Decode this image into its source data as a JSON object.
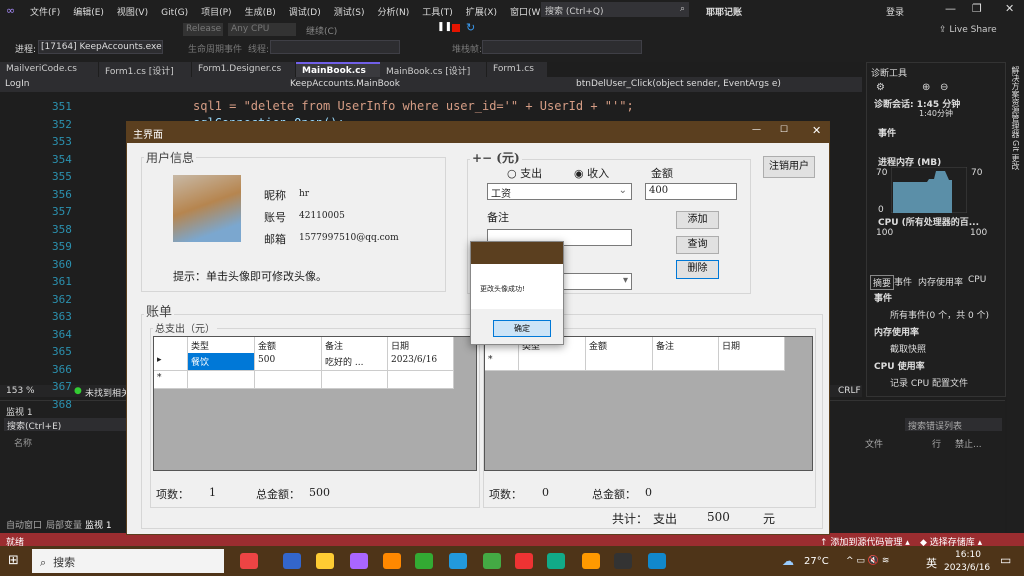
{
  "vs": {
    "menu": [
      "文件(F)",
      "编辑(E)",
      "视图(V)",
      "Git(G)",
      "项目(P)",
      "生成(B)",
      "调试(D)",
      "测试(S)",
      "分析(N)",
      "工具(T)",
      "扩展(X)",
      "窗口(W)",
      "帮助(H)"
    ],
    "search_placeholder": "搜索 (Ctrl+Q)",
    "solution_title": "耶耶记账",
    "login": "登录",
    "live_share": "Live Share",
    "config": "Release",
    "platform": "Any CPU",
    "continue": "继续(C)",
    "process_label": "进程:",
    "process": "[17164] KeepAccounts.exe",
    "lifecycle": "生命周期事件",
    "thread": "线程:",
    "stack": "堆栈帧:",
    "tabs": [
      "MailveriCode.cs",
      "Form1.cs [设计]",
      "Form1.Designer.cs",
      "MainBook.cs",
      "MainBook.cs [设计]",
      "Form1.cs"
    ],
    "nav": [
      "LogIn",
      "KeepAccounts.MainBook",
      "btnDelUser_Click(object sender, EventArgs e)"
    ],
    "line_numbers": [
      "351",
      "352",
      "353",
      "354",
      "355",
      "356",
      "357",
      "358",
      "359",
      "360",
      "361",
      "362",
      "363",
      "364",
      "365",
      "366",
      "367",
      "368"
    ],
    "code_line_351": "sql1 = \"delete from UserInfo where user_id='\" + UserId + \"'\";",
    "code_line_352": "sqlConnection.Open();",
    "zoom": "153 %",
    "issues": "未找到相关问题",
    "eol": "CRLF",
    "watch_title": "监视 1",
    "watch_search": "搜索(Ctrl+E)",
    "watch_col": "名称",
    "bottom_tabs": [
      "自动窗口",
      "局部变量",
      "监视 1"
    ],
    "error_search": "搜索错误列表",
    "error_cols": [
      "文件",
      "行",
      "禁止..."
    ],
    "status": "就绪",
    "add_source": "添加到源代码管理",
    "select_repo": "选择存储库",
    "diag": {
      "title": "诊断工具",
      "session": "诊断会话: 1:45 分钟",
      "timeline": "1:40分钟",
      "events": "事件",
      "memory": "进程内存 (MB)",
      "cpu": "CPU (所有处理器的百...",
      "mem_max": "70",
      "mem_min": "0",
      "cpu_max": "100",
      "tabs": [
        "摘要",
        "事件",
        "内存使用率",
        "CPU"
      ],
      "sections": [
        {
          "h": "事件",
          "item": "所有事件(0 个，共 0 个)"
        },
        {
          "h": "内存使用率",
          "item": "截取快照"
        },
        {
          "h": "CPU 使用率",
          "item": "记录 CPU 配置文件"
        }
      ]
    },
    "side_tabs": [
      "解决方案资源管理器",
      "Git 更改"
    ]
  },
  "app": {
    "title": "主界面",
    "user_group": "用户信息",
    "nickname_label": "昵称",
    "nickname": "hr",
    "account_label": "账号",
    "account": "42110005",
    "email_label": "邮箱",
    "email": "1577997510@qq.com",
    "hint": "提示：单击头像即可修改头像。",
    "entry_group": "+− (元)",
    "radio_expense": "支出",
    "radio_income": "收入",
    "selected": "收入",
    "amount_label": "金额",
    "amount": "400",
    "category": "工资",
    "note_label": "备注",
    "note": "",
    "add": "添加",
    "query": "查询",
    "delete": "删除",
    "logout": "注销用户",
    "bill_group": "账单",
    "expense_group": "总支出（元）",
    "columns": [
      "类型",
      "金额",
      "备注",
      "日期"
    ],
    "expense_rows": [
      [
        "餐饮",
        "500",
        "吃好的 ...",
        "2023/6/16"
      ]
    ],
    "count_label": "项数：",
    "total_label": "总金额：",
    "expense_count": "1",
    "expense_total": "500",
    "income_count": "0",
    "income_total": "0",
    "sum_label": "共计：",
    "sum_type": "支出",
    "sum_value": "500",
    "sum_unit": "元"
  },
  "dialog": {
    "message": "更改头像成功!",
    "ok": "确定"
  },
  "taskbar": {
    "search": "搜索",
    "weather": "27°C",
    "ime": "英",
    "time": "16:10",
    "date": "2023/6/16"
  }
}
